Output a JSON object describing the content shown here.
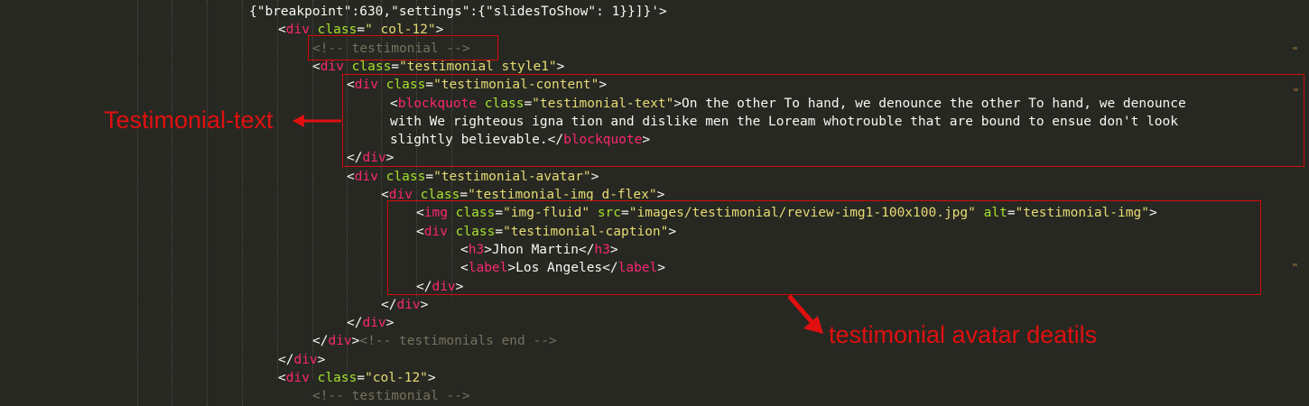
{
  "code_lines": [
    {
      "segments": [
        {
          "cls": "p",
          "text": "{\"breakpoint\":630,\"settings\":{\"slidesToShow\": 1}}]}'>"
        }
      ]
    },
    {
      "segments": [
        {
          "cls": "p",
          "text": "<"
        },
        {
          "cls": "t",
          "text": "div"
        },
        {
          "cls": "p",
          "text": " "
        },
        {
          "cls": "a",
          "text": "class"
        },
        {
          "cls": "p",
          "text": "="
        },
        {
          "cls": "s",
          "text": "\" col-12\""
        },
        {
          "cls": "p",
          "text": ">"
        }
      ]
    },
    {
      "segments": [
        {
          "cls": "c",
          "text": "<!-- testimonial -->"
        }
      ]
    },
    {
      "segments": [
        {
          "cls": "p",
          "text": "<"
        },
        {
          "cls": "t",
          "text": "div"
        },
        {
          "cls": "p",
          "text": " "
        },
        {
          "cls": "a",
          "text": "class"
        },
        {
          "cls": "p",
          "text": "="
        },
        {
          "cls": "s",
          "text": "\"testimonial style1\""
        },
        {
          "cls": "p",
          "text": ">"
        }
      ]
    },
    {
      "segments": [
        {
          "cls": "p",
          "text": "<"
        },
        {
          "cls": "t",
          "text": "div"
        },
        {
          "cls": "p",
          "text": " "
        },
        {
          "cls": "a",
          "text": "class"
        },
        {
          "cls": "p",
          "text": "="
        },
        {
          "cls": "s",
          "text": "\"testimonial-content\""
        },
        {
          "cls": "p",
          "text": ">"
        }
      ]
    },
    {
      "segments": [
        {
          "cls": "p",
          "text": "<"
        },
        {
          "cls": "t",
          "text": "blockquote"
        },
        {
          "cls": "p",
          "text": " "
        },
        {
          "cls": "a",
          "text": "class"
        },
        {
          "cls": "p",
          "text": "="
        },
        {
          "cls": "s",
          "text": "\"testimonial-text\""
        },
        {
          "cls": "p",
          "text": ">On the other To hand, we denounce the other To hand, we denounce"
        }
      ]
    },
    {
      "segments": [
        {
          "cls": "p",
          "text": "with We righteous igna tion and dislike men the Loream whotrouble that are bound to ensue don't look"
        }
      ]
    },
    {
      "segments": [
        {
          "cls": "p",
          "text": "slightly believable.</"
        },
        {
          "cls": "t",
          "text": "blockquote"
        },
        {
          "cls": "p",
          "text": ">"
        }
      ]
    },
    {
      "segments": [
        {
          "cls": "p",
          "text": "</"
        },
        {
          "cls": "t",
          "text": "div"
        },
        {
          "cls": "p",
          "text": ">"
        }
      ]
    },
    {
      "segments": [
        {
          "cls": "p",
          "text": "<"
        },
        {
          "cls": "t",
          "text": "div"
        },
        {
          "cls": "p",
          "text": " "
        },
        {
          "cls": "a",
          "text": "class"
        },
        {
          "cls": "p",
          "text": "="
        },
        {
          "cls": "s",
          "text": "\"testimonial-avatar\""
        },
        {
          "cls": "p",
          "text": ">"
        }
      ]
    },
    {
      "segments": [
        {
          "cls": "p",
          "text": "<"
        },
        {
          "cls": "t",
          "text": "div"
        },
        {
          "cls": "p",
          "text": " "
        },
        {
          "cls": "a",
          "text": "class"
        },
        {
          "cls": "p",
          "text": "="
        },
        {
          "cls": "s",
          "text": "\"testimonial-img d-flex\""
        },
        {
          "cls": "p",
          "text": ">"
        }
      ]
    },
    {
      "segments": [
        {
          "cls": "p",
          "text": "<"
        },
        {
          "cls": "t",
          "text": "img"
        },
        {
          "cls": "p",
          "text": " "
        },
        {
          "cls": "a",
          "text": "class"
        },
        {
          "cls": "p",
          "text": "="
        },
        {
          "cls": "s",
          "text": "\"img-fluid\""
        },
        {
          "cls": "p",
          "text": " "
        },
        {
          "cls": "a",
          "text": "src"
        },
        {
          "cls": "p",
          "text": "="
        },
        {
          "cls": "s",
          "text": "\"images/testimonial/review-img1-100x100.jpg\""
        },
        {
          "cls": "p",
          "text": " "
        },
        {
          "cls": "a",
          "text": "alt"
        },
        {
          "cls": "p",
          "text": "="
        },
        {
          "cls": "s",
          "text": "\"testimonial-img\""
        },
        {
          "cls": "p",
          "text": ">"
        }
      ]
    },
    {
      "segments": [
        {
          "cls": "p",
          "text": "<"
        },
        {
          "cls": "t",
          "text": "div"
        },
        {
          "cls": "p",
          "text": " "
        },
        {
          "cls": "a",
          "text": "class"
        },
        {
          "cls": "p",
          "text": "="
        },
        {
          "cls": "s",
          "text": "\"testimonial-caption\""
        },
        {
          "cls": "p",
          "text": ">"
        }
      ]
    },
    {
      "segments": [
        {
          "cls": "p",
          "text": "<"
        },
        {
          "cls": "t",
          "text": "h3"
        },
        {
          "cls": "p",
          "text": ">Jhon Martin</"
        },
        {
          "cls": "t",
          "text": "h3"
        },
        {
          "cls": "p",
          "text": ">"
        }
      ]
    },
    {
      "segments": [
        {
          "cls": "p",
          "text": "<"
        },
        {
          "cls": "t",
          "text": "label"
        },
        {
          "cls": "p",
          "text": ">Los Angeles</"
        },
        {
          "cls": "t",
          "text": "label"
        },
        {
          "cls": "p",
          "text": ">"
        }
      ]
    },
    {
      "segments": [
        {
          "cls": "p",
          "text": "</"
        },
        {
          "cls": "t",
          "text": "div"
        },
        {
          "cls": "p",
          "text": ">"
        }
      ]
    },
    {
      "segments": [
        {
          "cls": "p",
          "text": "</"
        },
        {
          "cls": "t",
          "text": "div"
        },
        {
          "cls": "p",
          "text": ">"
        }
      ]
    },
    {
      "segments": [
        {
          "cls": "p",
          "text": "</"
        },
        {
          "cls": "t",
          "text": "div"
        },
        {
          "cls": "p",
          "text": ">"
        }
      ]
    },
    {
      "segments": [
        {
          "cls": "p",
          "text": "</"
        },
        {
          "cls": "t",
          "text": "div"
        },
        {
          "cls": "p",
          "text": ">"
        },
        {
          "cls": "c",
          "text": "<!-- testimonials end -->"
        }
      ]
    },
    {
      "segments": [
        {
          "cls": "p",
          "text": "</"
        },
        {
          "cls": "t",
          "text": "div"
        },
        {
          "cls": "p",
          "text": ">"
        }
      ]
    },
    {
      "segments": [
        {
          "cls": "p",
          "text": "<"
        },
        {
          "cls": "t",
          "text": "div"
        },
        {
          "cls": "p",
          "text": " "
        },
        {
          "cls": "a",
          "text": "class"
        },
        {
          "cls": "p",
          "text": "="
        },
        {
          "cls": "s",
          "text": "\"col-12\""
        },
        {
          "cls": "p",
          "text": ">"
        }
      ]
    },
    {
      "segments": [
        {
          "cls": "c",
          "text": "<!-- testimonial -->"
        }
      ]
    }
  ],
  "annotations": {
    "text_label": "Testimonial-text",
    "avatar_label": "testimonial avatar deatils"
  },
  "colors": {
    "background": "#272822",
    "tag": "#f92672",
    "attribute": "#a6e22e",
    "string": "#e6db74",
    "comment": "#75715e",
    "annotation": "#e01010"
  }
}
